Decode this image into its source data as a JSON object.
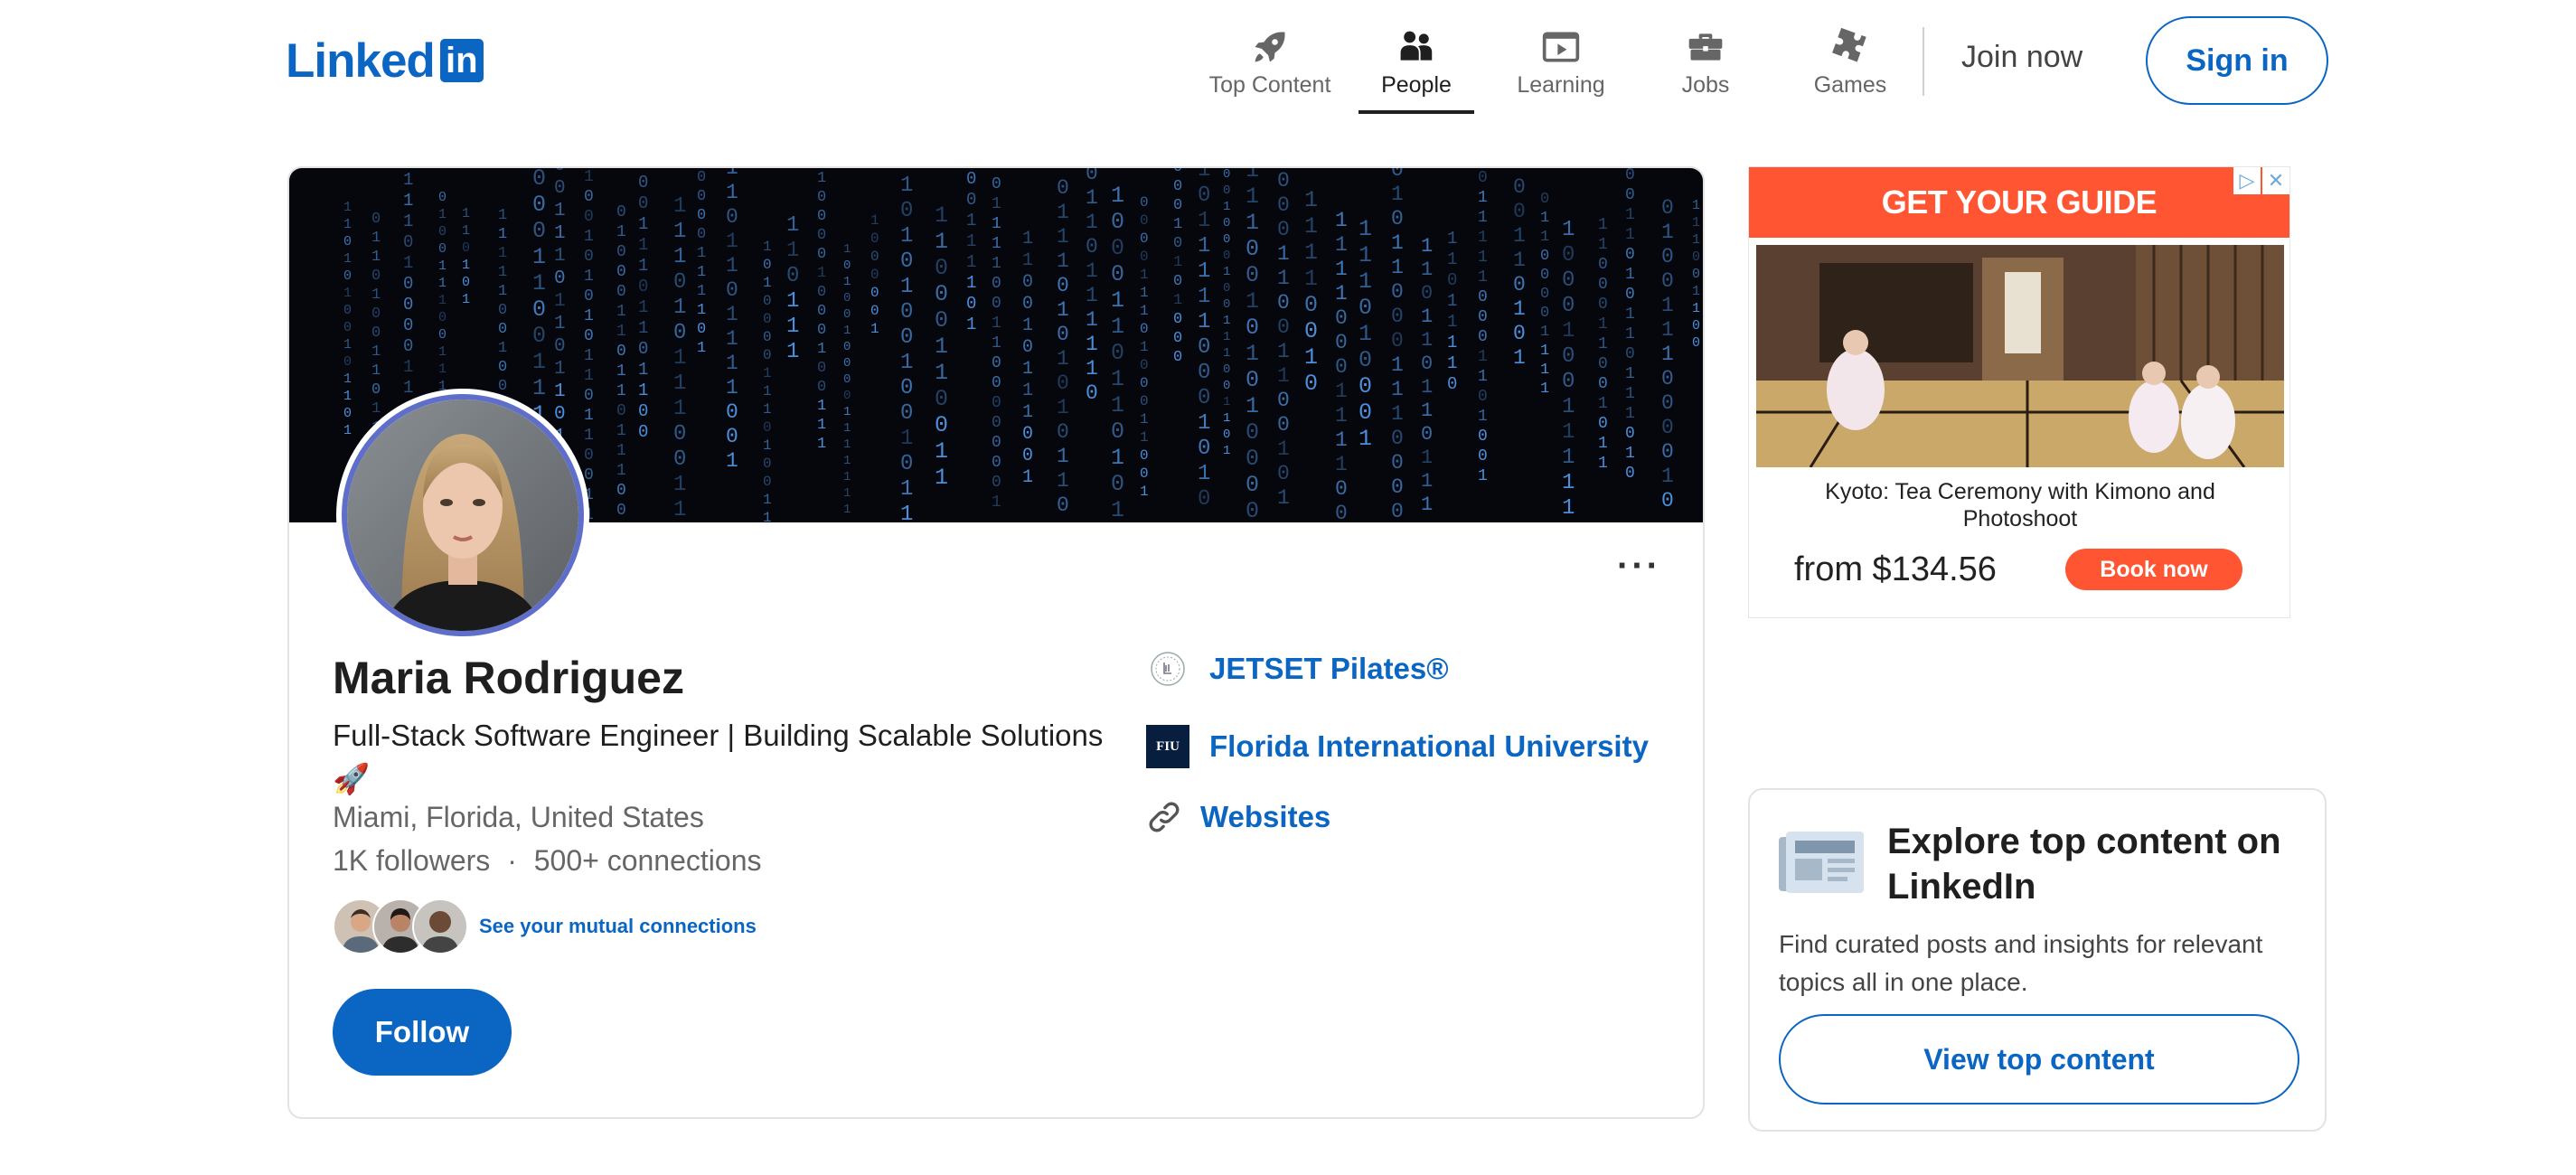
{
  "brand": {
    "logo_text": "Linked",
    "logo_box": "in",
    "color": "#0a66c2"
  },
  "nav": {
    "items": [
      {
        "label": "Top Content",
        "icon": "rocket-icon",
        "active": false
      },
      {
        "label": "People",
        "icon": "people-icon",
        "active": true
      },
      {
        "label": "Learning",
        "icon": "video-play-icon",
        "active": false
      },
      {
        "label": "Jobs",
        "icon": "briefcase-icon",
        "active": false
      },
      {
        "label": "Games",
        "icon": "puzzle-icon",
        "active": false
      }
    ],
    "join_label": "Join now",
    "signin_label": "Sign in"
  },
  "profile": {
    "name": "Maria Rodriguez",
    "headline": "Full-Stack Software Engineer | Building Scalable Solutions 🚀",
    "location": "Miami, Florida, United States",
    "followers": "1K followers",
    "separator": "·",
    "connections": "500+ connections",
    "mutual_link": "See your mutual connections",
    "follow_label": "Follow",
    "more_label": "···",
    "cover_icon": "binary-rain-image",
    "avatar_icon": "profile-photo"
  },
  "side_links": {
    "company": {
      "label": "JETSET Pilates®",
      "icon": "jetset-logo-icon"
    },
    "school": {
      "label": "Florida International University",
      "icon": "fiu-logo-icon",
      "badge": "FIU"
    },
    "websites": {
      "label": "Websites",
      "icon": "link-icon"
    }
  },
  "ad": {
    "brand": "GET YOUR GUIDE",
    "choices": [
      "▷",
      "✕"
    ],
    "title": "Kyoto: Tea Ceremony with Kimono and Photoshoot",
    "price": "from $134.56",
    "cta": "Book now",
    "accent": "#ff5533"
  },
  "explore": {
    "title": "Explore top content on LinkedIn",
    "description": "Find curated posts and insights for relevant topics all in one place.",
    "button": "View top content",
    "icon": "newspaper-icon"
  }
}
